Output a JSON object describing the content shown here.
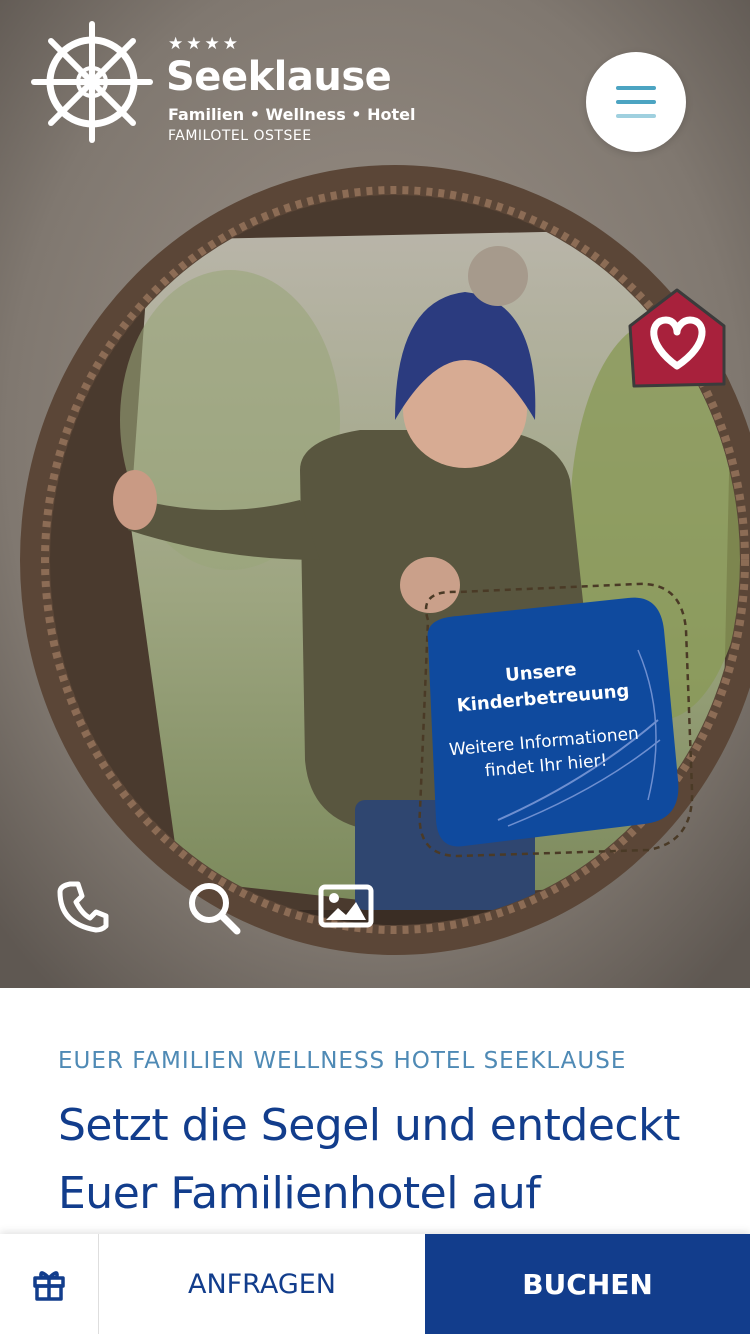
{
  "brand": {
    "stars": "★★★★",
    "name": "Seeklause",
    "tagline": "Familien • Wellness • Hotel",
    "subline": "FAMILOTEL OSTSEE"
  },
  "colors": {
    "primary": "#123d8c",
    "accent": "#4ca4c2",
    "eyebrow": "#4f8ab5",
    "badge_red": "#a8213c",
    "card_blue": "#0f4a9e"
  },
  "hero": {
    "icons": [
      "wheel-logo-icon",
      "menu-icon",
      "heart-house-icon",
      "phone-icon",
      "search-icon",
      "gallery-icon"
    ],
    "kids_card": {
      "title": "Unsere Kinderbetreuung",
      "text": "Weitere Informationen findet Ihr hier!"
    }
  },
  "content": {
    "eyebrow": "EUER FAMILIEN WELLNESS HOTEL SEEKLAUSE",
    "headline": "Setzt die Segel und entdeckt Euer Familienhotel auf"
  },
  "bottom_bar": {
    "gift_icon": "gift-icon",
    "ask_label": "ANFRAGEN",
    "book_label": "BUCHEN"
  }
}
